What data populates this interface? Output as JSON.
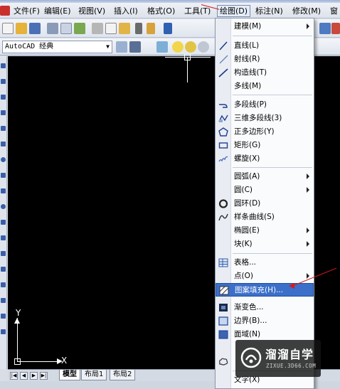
{
  "menubar": {
    "items": [
      "文件(F)",
      "编辑(E)",
      "视图(V)",
      "插入(I)",
      "格式(O)",
      "工具(T)",
      "绘图(D)",
      "标注(N)",
      "修改(M)",
      "窗"
    ]
  },
  "toolbar": {
    "workspace_value": "AutoCAD 经典"
  },
  "draw_menu": {
    "items": [
      {
        "label": "建模(M)",
        "submenu": true,
        "icon": ""
      },
      {
        "label": "直线(L)",
        "icon": "line-icon"
      },
      {
        "label": "射线(R)",
        "icon": "ray-icon"
      },
      {
        "label": "构造线(T)",
        "icon": "xline-icon"
      },
      {
        "label": "多线(M)",
        "icon": ""
      },
      {
        "label": "多段线(P)",
        "icon": "polyline-icon"
      },
      {
        "label": "三维多段线(3)",
        "icon": "3dpolyline-icon"
      },
      {
        "label": "正多边形(Y)",
        "icon": "polygon-icon"
      },
      {
        "label": "矩形(G)",
        "icon": "rectangle-icon"
      },
      {
        "label": "螺旋(X)",
        "icon": "helix-icon"
      },
      {
        "label": "圆弧(A)",
        "submenu": true,
        "icon": ""
      },
      {
        "label": "圆(C)",
        "submenu": true,
        "icon": ""
      },
      {
        "label": "圆环(D)",
        "icon": "donut-icon"
      },
      {
        "label": "样条曲线(S)",
        "icon": "spline-icon"
      },
      {
        "label": "椭圆(E)",
        "submenu": true,
        "icon": ""
      },
      {
        "label": "块(K)",
        "submenu": true,
        "icon": ""
      },
      {
        "label": "表格...",
        "icon": "table-icon"
      },
      {
        "label": "点(O)",
        "submenu": true,
        "icon": ""
      },
      {
        "label": "图案填充(H)...",
        "icon": "hatch-icon",
        "highlighted": true
      },
      {
        "label": "渐变色...",
        "icon": "gradient-icon"
      },
      {
        "label": "边界(B)...",
        "icon": "boundary-icon"
      },
      {
        "label": "面域(N)",
        "icon": "region-icon"
      },
      {
        "label": "",
        "icon": ""
      },
      {
        "label": "",
        "icon": "revcloud-icon"
      },
      {
        "label": "文字(X)",
        "icon": ""
      }
    ]
  },
  "layout_tabs": [
    "模型",
    "布局1",
    "布局2"
  ],
  "ucs": {
    "x_label": "X",
    "y_label": "Y"
  },
  "watermark": {
    "brand": "溜溜自学",
    "url": "ZIXUE.3D66.COM"
  },
  "colors": {
    "highlight": "#3b6fc9",
    "canvas": "#000000",
    "annotation": "#d81818"
  }
}
